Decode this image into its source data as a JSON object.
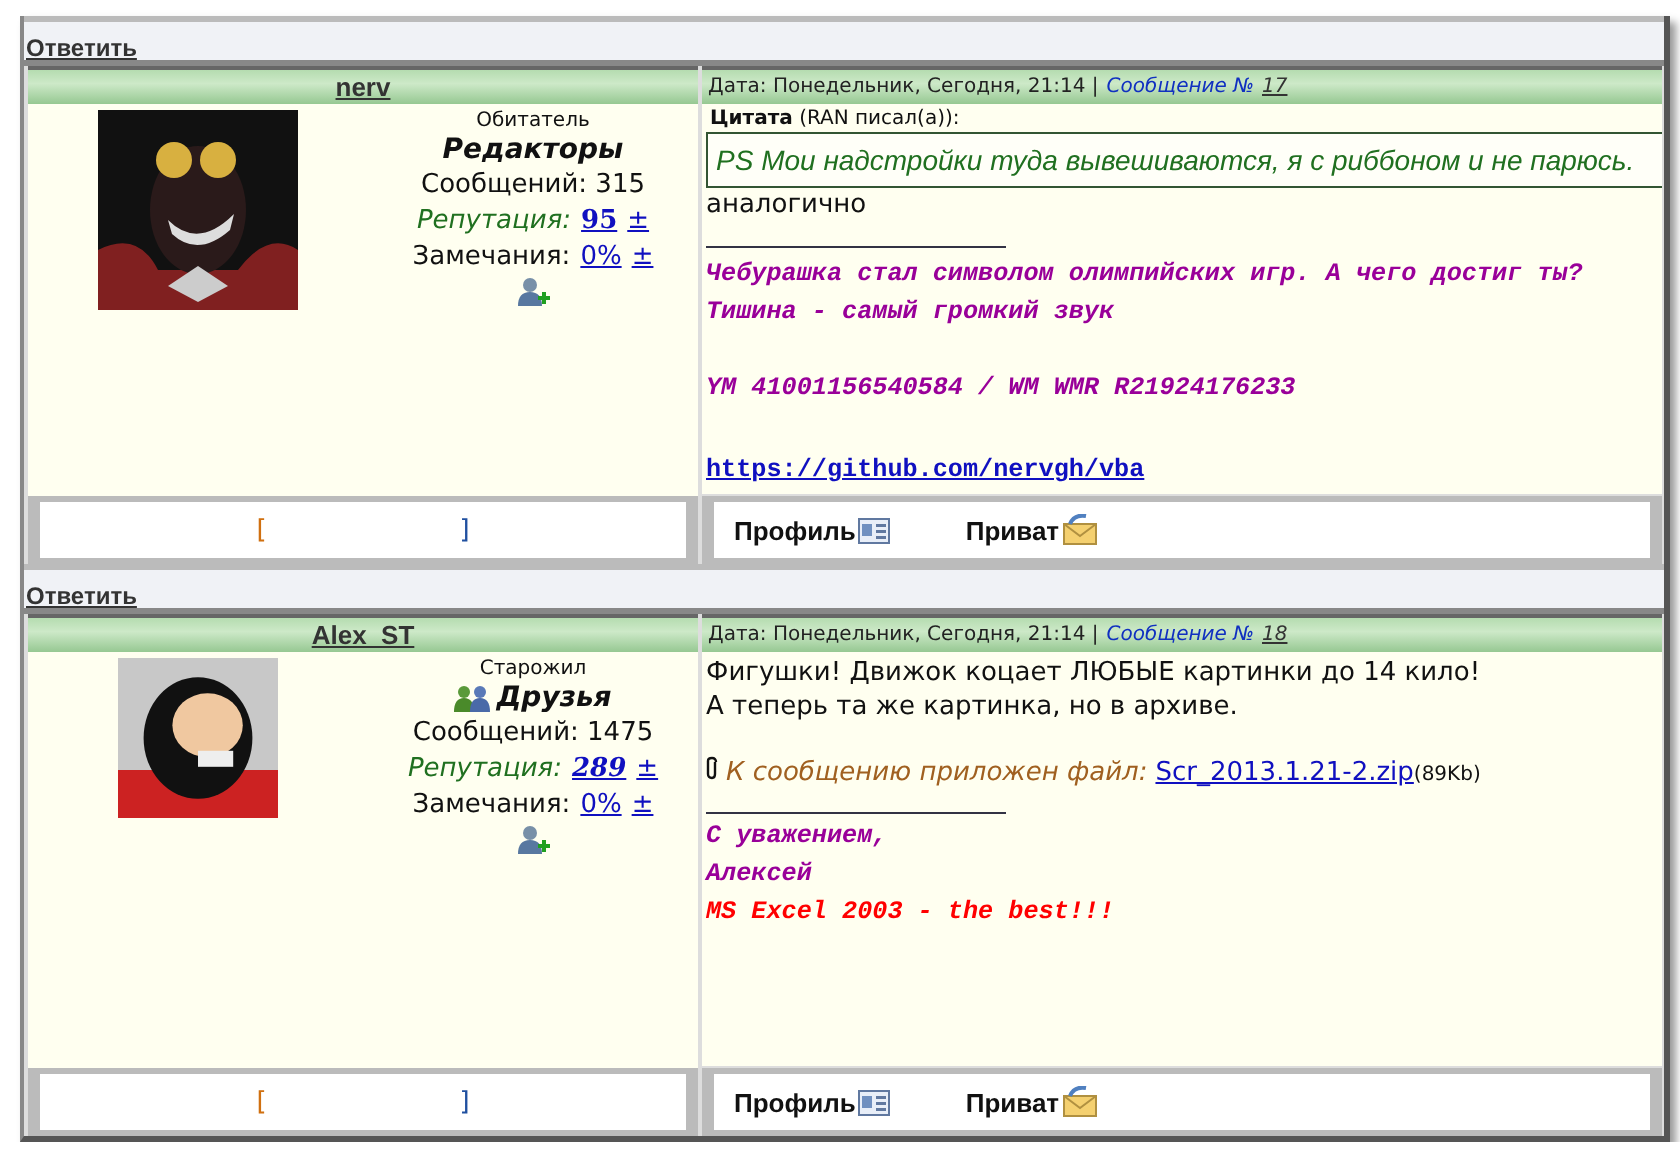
{
  "posts": [
    {
      "reply_link": "Ответить",
      "author": "nerv",
      "rank": "Обитатель",
      "group": "Редакторы",
      "group_icon": false,
      "messages": "Сообщений: 315",
      "reputation_label": "Репутация:",
      "reputation": "95",
      "reputation_italic": false,
      "reputation_change": "±",
      "remarks_label": "Замечания:",
      "remarks": "0%",
      "remarks_change": "±",
      "date": "Дата: Понедельник, Сегодня, 21:14 |",
      "message_label": "Сообщение №",
      "message_number": "17",
      "body": [
        {
          "kind": "quote",
          "title": "Цитата",
          "author": "(RAN писал(а)):",
          "text": "PS Мои надстройки туда вывешиваются, я с риббоном и не парюсь."
        },
        {
          "kind": "text",
          "text": "аналогично"
        },
        {
          "kind": "divider"
        },
        {
          "kind": "signature",
          "text": "Чебурашка стал символом олимпийских игр. А чего достиг ты?",
          "color": "#990099"
        },
        {
          "kind": "signature",
          "text": "Тишина - самый громкий звук",
          "color": "#990099"
        },
        {
          "kind": "spacer"
        },
        {
          "kind": "signature",
          "text": "YM 41001156540584 / WM WMR R21924176233",
          "color": "#990099"
        },
        {
          "kind": "spacer"
        },
        {
          "kind": "link",
          "text": "https://github.com/nervgh/vba"
        }
      ],
      "bracket_open": "[",
      "bracket_close": "]",
      "profile": "Профиль",
      "private": "Приват"
    },
    {
      "reply_link": "Ответить",
      "author": "Alex_ST",
      "rank": "Старожил",
      "group": "Друзья",
      "group_icon": true,
      "messages": "Сообщений: 1475",
      "reputation_label": "Репутация:",
      "reputation": "289",
      "reputation_italic": true,
      "reputation_change": "±",
      "remarks_label": "Замечания:",
      "remarks": "0%",
      "remarks_change": "±",
      "date": "Дата: Понедельник, Сегодня, 21:14 |",
      "message_label": "Сообщение №",
      "message_number": "18",
      "body": [
        {
          "kind": "text",
          "text": "Фигушки! Движок коцает ЛЮБЫЕ картинки до 14 кило!"
        },
        {
          "kind": "text",
          "text": "А теперь та же картинка, но в архиве."
        },
        {
          "kind": "attachment",
          "label": "К сообщению приложен файл:",
          "file": "Scr_2013.1.21-2.zip",
          "size": "(89Kb)"
        },
        {
          "kind": "divider"
        },
        {
          "kind": "signature",
          "text": "С уважением,",
          "color": "#990099"
        },
        {
          "kind": "signature",
          "text": "Алексей",
          "color": "#990099"
        },
        {
          "kind": "signature",
          "text": "MS Excel 2003 - the best!!!",
          "color": "#ff0000"
        }
      ],
      "bracket_open": "[",
      "bracket_close": "]",
      "profile": "Профиль",
      "private": "Приват"
    }
  ]
}
